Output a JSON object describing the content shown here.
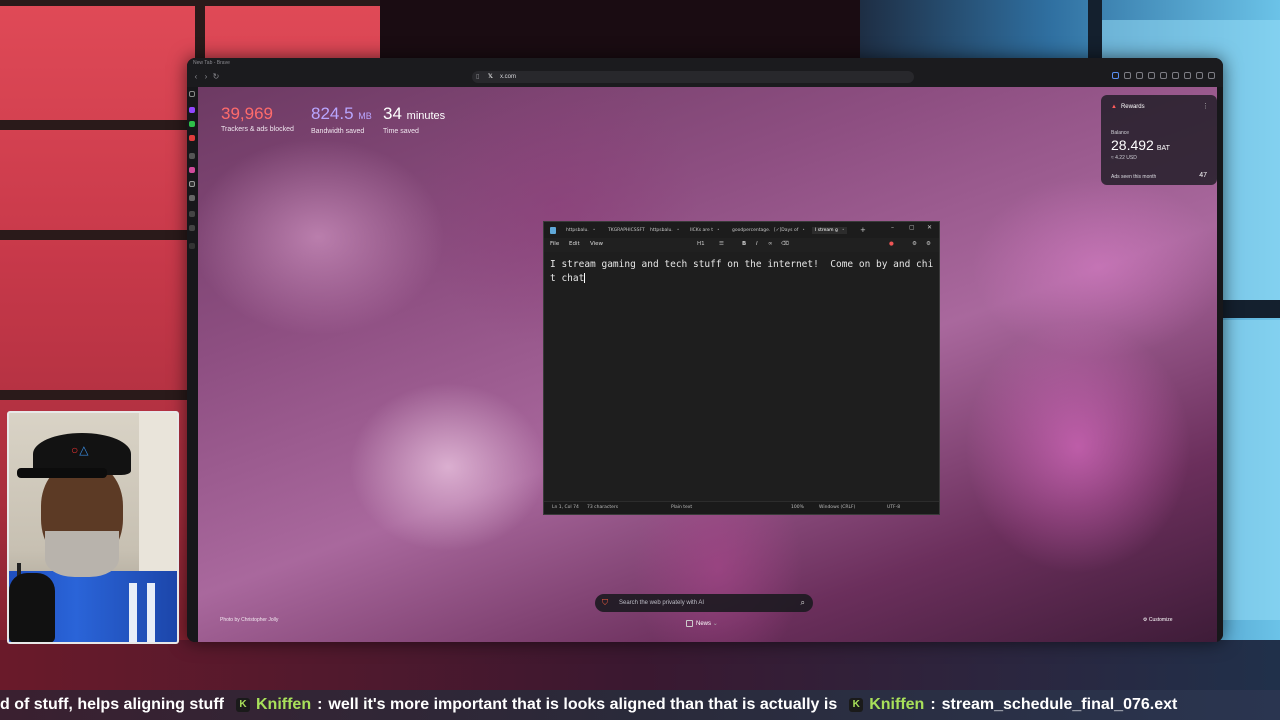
{
  "browser": {
    "window_title": "New Tab - Brave",
    "url": "x.com"
  },
  "ntp": {
    "stats": [
      {
        "value": "39,969",
        "unit": "",
        "label": "Trackers & ads blocked",
        "color": "#ff6b6b"
      },
      {
        "value": "824.5",
        "unit": "MB",
        "label": "Bandwidth saved",
        "color": "#b9a6ff"
      },
      {
        "value": "34",
        "unit": "minutes",
        "label": "Time saved",
        "color": "#ffffff"
      }
    ],
    "rewards": {
      "title": "Rewards",
      "balance_label": "Balance",
      "balance": "28.492",
      "currency": "BAT",
      "usd": "≈ 4.22 USD",
      "ads_label": "Ads seen this month",
      "ads_count": "47"
    },
    "photo_credit": "Photo by Christopher Jolly",
    "search_placeholder": "Search the web privately with AI",
    "news_label": "News",
    "customize_label": "Customize"
  },
  "notepad": {
    "tabs": [
      "httpsbalu.",
      "TKGRAPHICSSFT",
      "httpsbalu.",
      "IICKs are t",
      "goodpercentage.",
      "[✓]Days of",
      "I stream g"
    ],
    "active_tab_index": 6,
    "menu": [
      "File",
      "Edit",
      "View"
    ],
    "heading_selector": "H1",
    "text": "I stream gaming and tech stuff on the internet!  Come on by and chit chat",
    "status": {
      "position": "Ln 1, Col 74",
      "chars": "73 characters",
      "format": "Plain text",
      "zoom": "100%",
      "line_ending": "Windows (CRLF)",
      "encoding": "UTF-8"
    }
  },
  "ticker": {
    "lead_text": "d of stuff, helps aligning stuff",
    "messages": [
      {
        "user": "Kniffen",
        "text": "well it's more important that is looks aligned than that is actually is"
      },
      {
        "user": "Kniffen",
        "text": "stream_schedule_final_076.ext"
      }
    ]
  }
}
